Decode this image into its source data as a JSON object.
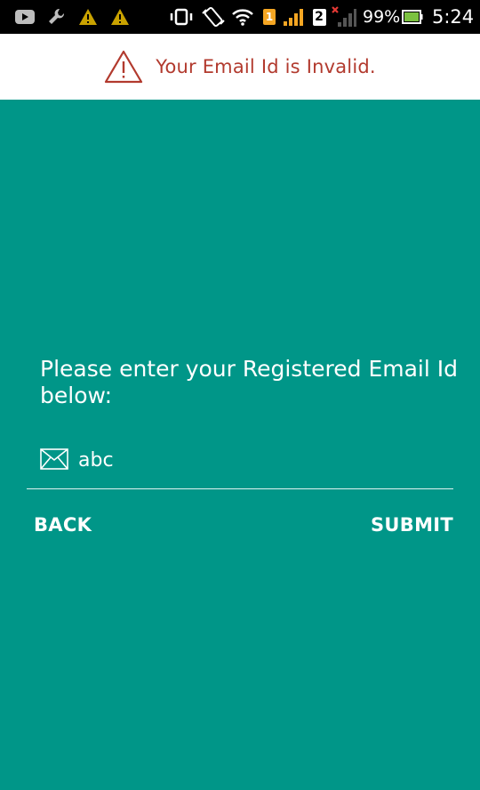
{
  "status_bar": {
    "battery_text": "99%",
    "time": "5:24",
    "sim1_badge": "1",
    "sim2_badge": "2",
    "icons": [
      "youtube-icon",
      "wrench-icon",
      "warning-icon",
      "warning-icon",
      "vibrate-icon",
      "rotate-icon",
      "wifi-icon",
      "sim1-icon",
      "signal-icon",
      "sim2-icon",
      "no-signal-icon",
      "battery-icon"
    ]
  },
  "error_banner": {
    "message": "Your Email Id is Invalid.",
    "icon": "warning-triangle-icon",
    "color": "#b23a2e"
  },
  "form": {
    "prompt": "Please enter your Registered Email Id below:",
    "email_value": "abc",
    "email_icon": "mail-icon"
  },
  "actions": {
    "back_label": "BACK",
    "submit_label": "SUBMIT"
  },
  "colors": {
    "background": "#009688",
    "status_bar": "#000000",
    "banner": "#ffffff"
  }
}
